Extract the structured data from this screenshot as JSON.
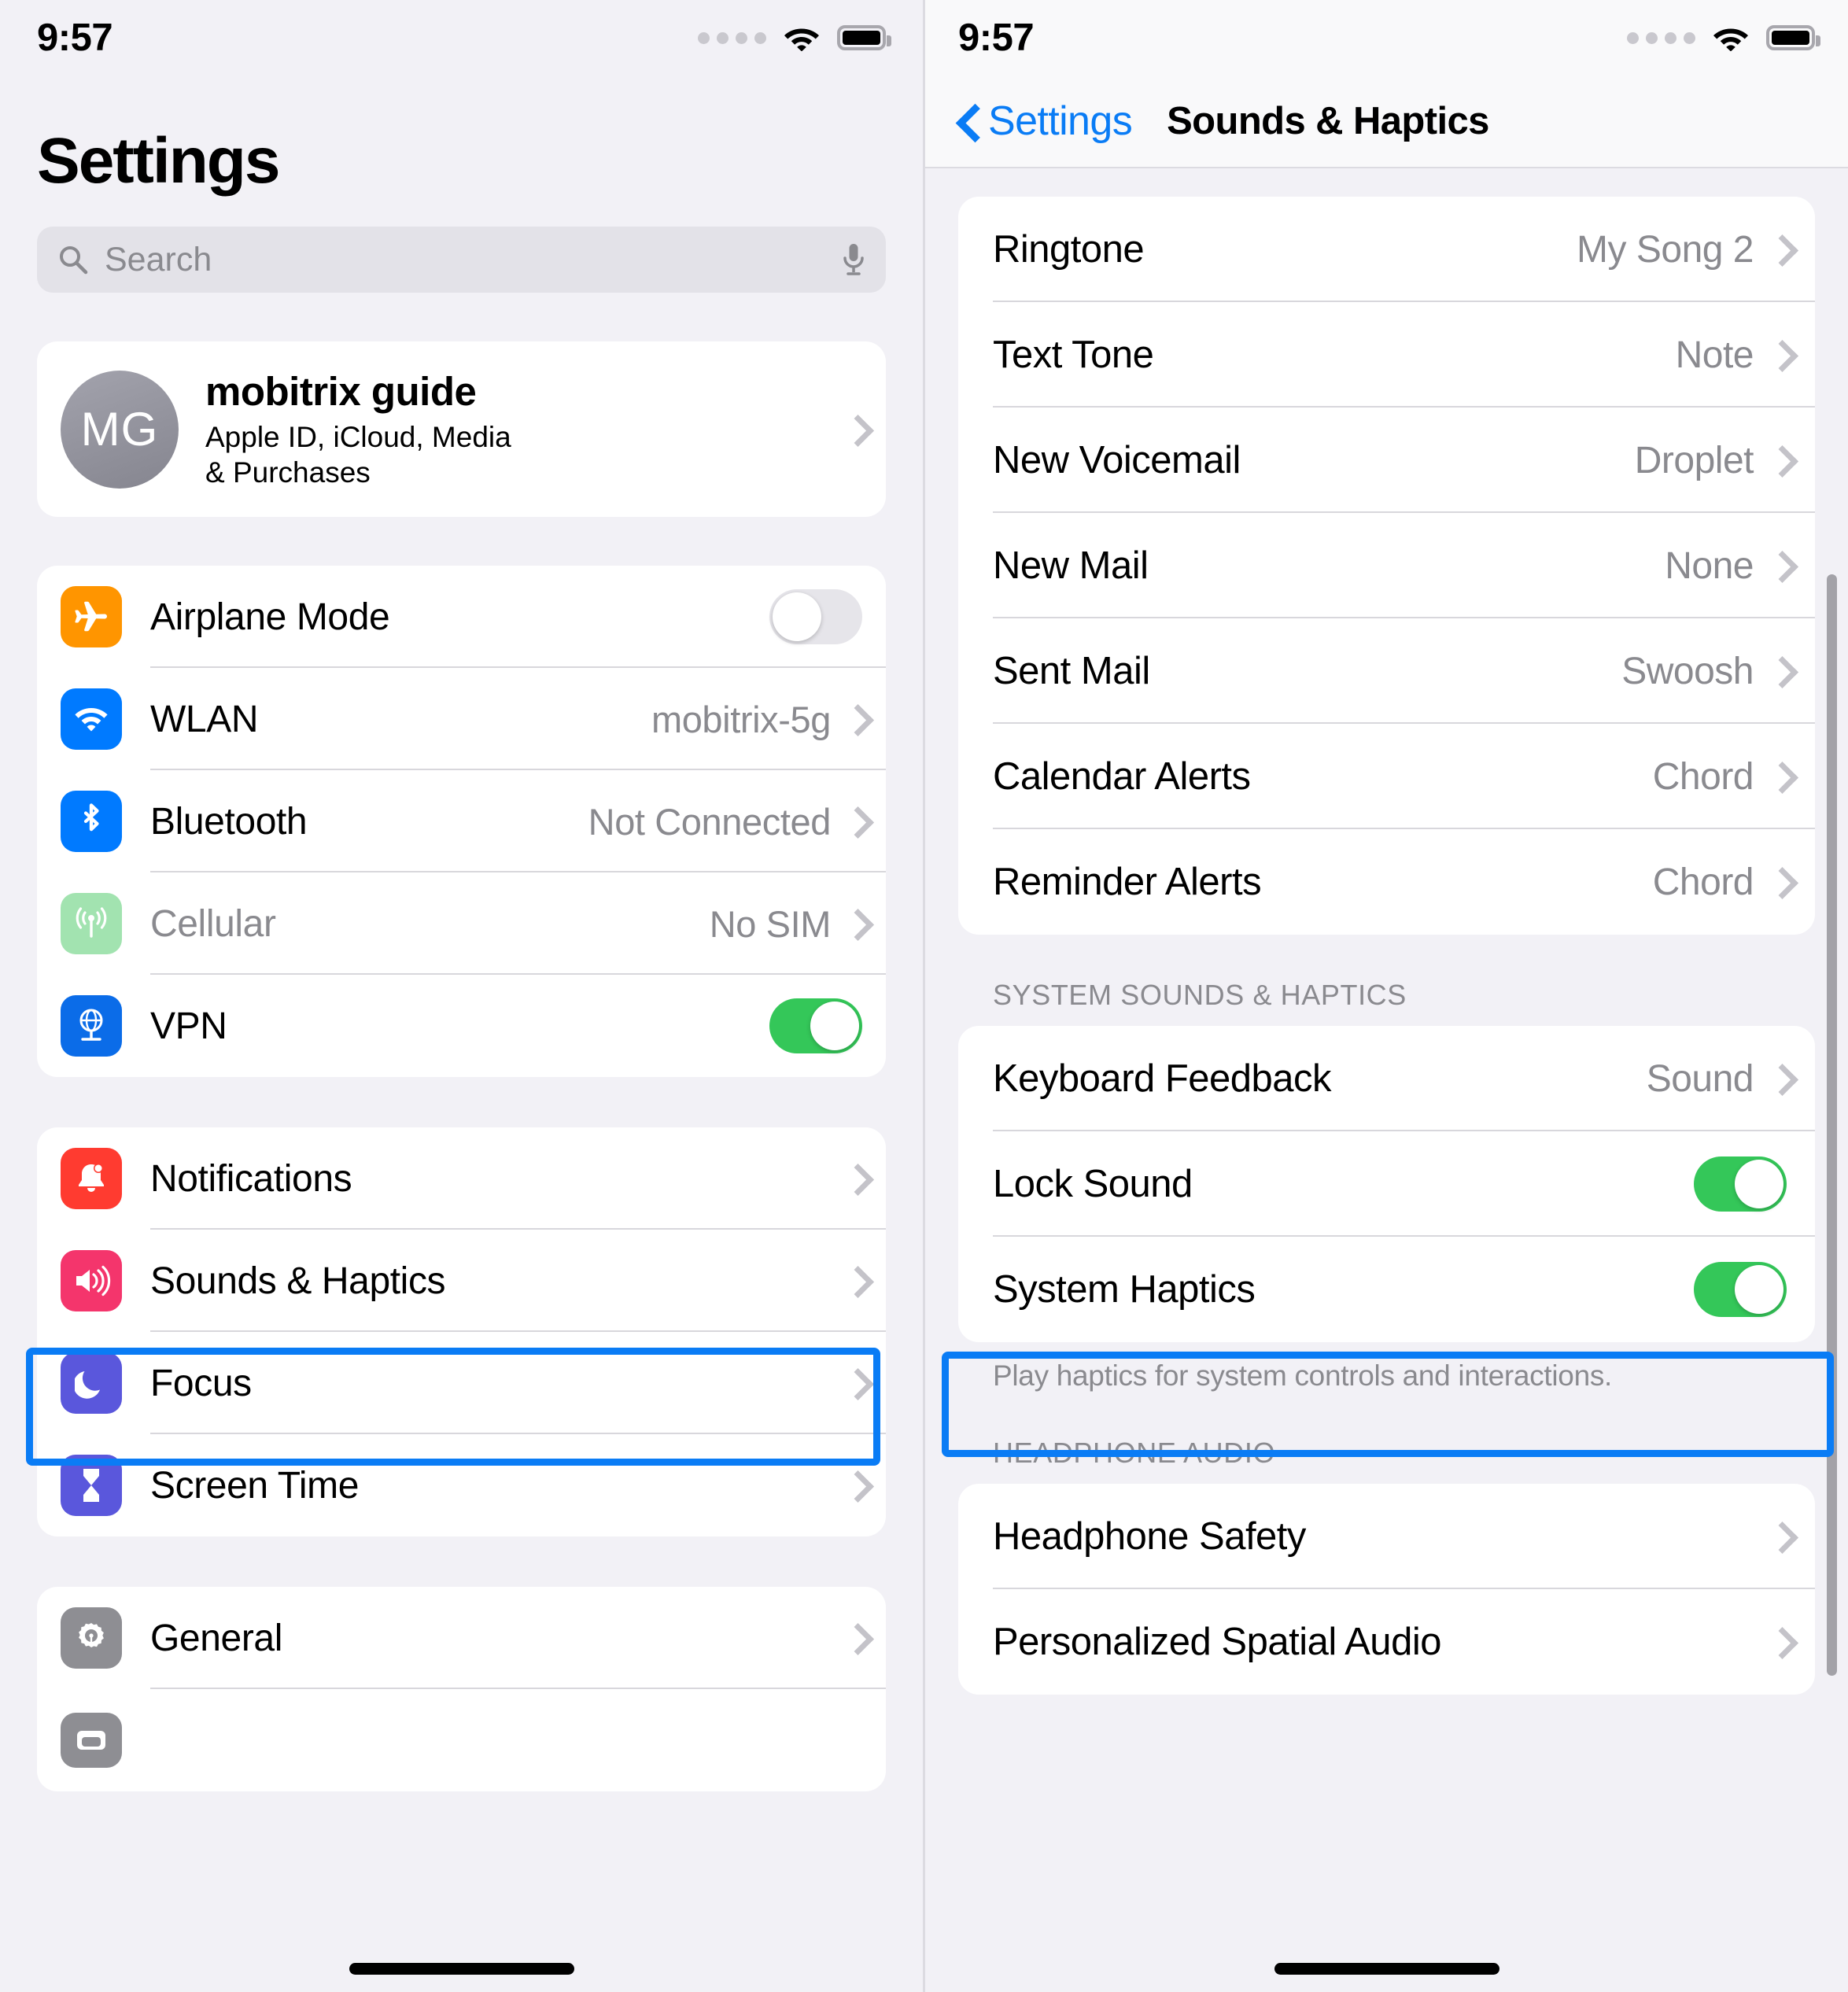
{
  "status_bar": {
    "time": "9:57",
    "signal_icon": "cellular-dots-icon",
    "wifi_icon": "wifi-icon",
    "battery_icon": "battery-full-icon"
  },
  "left_panel": {
    "title": "Settings",
    "search": {
      "placeholder": "Search",
      "icon": "search-icon",
      "mic_icon": "microphone-icon"
    },
    "profile": {
      "initials": "MG",
      "name": "mobitrix guide",
      "subtitle_line1": "Apple ID, iCloud, Media",
      "subtitle_line2": "& Purchases"
    },
    "group_connectivity": [
      {
        "label": "Airplane Mode",
        "icon": "airplane-icon",
        "icon_color": "#ff9500",
        "control": "toggle",
        "toggle_on": false
      },
      {
        "label": "WLAN",
        "icon": "wifi-icon",
        "icon_color": "#007aff",
        "control": "value",
        "value": "mobitrix-5g"
      },
      {
        "label": "Bluetooth",
        "icon": "bluetooth-icon",
        "icon_color": "#007aff",
        "control": "value",
        "value": "Not Connected"
      },
      {
        "label": "Cellular",
        "icon": "cellular-antenna-icon",
        "icon_color": "#a2e3b0",
        "control": "value",
        "value": "No SIM",
        "disabled": true
      },
      {
        "label": "VPN",
        "icon": "vpn-globe-icon",
        "icon_color": "#0b6ce8",
        "control": "toggle",
        "toggle_on": true
      }
    ],
    "group_system": [
      {
        "label": "Notifications",
        "icon": "bell-icon",
        "icon_color": "#ff3b30",
        "control": "chevron"
      },
      {
        "label": "Sounds & Haptics",
        "icon": "speaker-waves-icon",
        "icon_color": "#f4356c",
        "control": "chevron",
        "highlighted": true
      },
      {
        "label": "Focus",
        "icon": "moon-icon",
        "icon_color": "#5a57dc",
        "control": "chevron"
      },
      {
        "label": "Screen Time",
        "icon": "hourglass-icon",
        "icon_color": "#5a57dc",
        "control": "chevron"
      }
    ],
    "group_general": [
      {
        "label": "General",
        "icon": "gear-icon",
        "icon_color": "#8e8e93",
        "control": "chevron"
      }
    ],
    "highlight_color": "#0a7cf5"
  },
  "right_panel": {
    "nav": {
      "back_label": "Settings",
      "back_icon": "chevron-left-icon",
      "title": "Sounds & Haptics"
    },
    "group_tones": [
      {
        "label": "Ringtone",
        "value": "My Song 2"
      },
      {
        "label": "Text Tone",
        "value": "Note"
      },
      {
        "label": "New Voicemail",
        "value": "Droplet"
      },
      {
        "label": "New Mail",
        "value": "None"
      },
      {
        "label": "Sent Mail",
        "value": "Swoosh"
      },
      {
        "label": "Calendar Alerts",
        "value": "Chord"
      },
      {
        "label": "Reminder Alerts",
        "value": "Chord"
      }
    ],
    "system_section": {
      "header": "SYSTEM SOUNDS & HAPTICS",
      "rows": [
        {
          "label": "Keyboard Feedback",
          "control": "value",
          "value": "Sound"
        },
        {
          "label": "Lock Sound",
          "control": "toggle",
          "toggle_on": true
        },
        {
          "label": "System Haptics",
          "control": "toggle",
          "toggle_on": true,
          "highlighted": true
        }
      ],
      "footer": "Play haptics for system controls and interactions."
    },
    "headphone_section": {
      "header": "HEADPHONE AUDIO",
      "rows": [
        {
          "label": "Headphone Safety",
          "control": "chevron"
        },
        {
          "label": "Personalized Spatial Audio",
          "control": "chevron"
        }
      ]
    },
    "highlight_color": "#0a7cf5"
  }
}
